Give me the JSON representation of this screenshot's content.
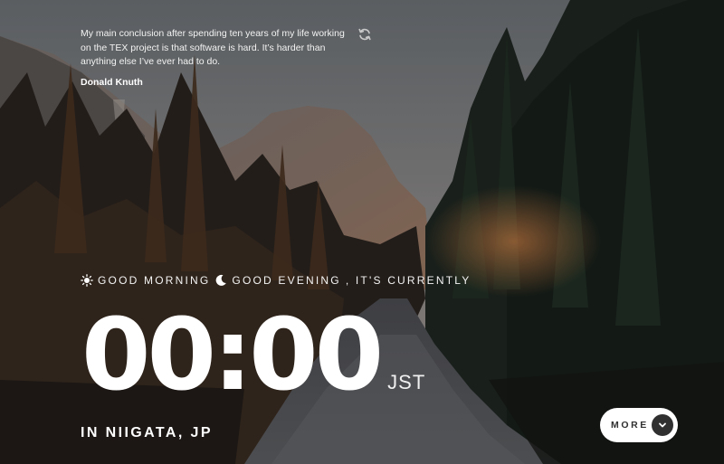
{
  "quote": {
    "text": "My main conclusion after spending ten years of my life working on the TEX project is that software is hard. It’s harder than anything else I’ve ever had to do.",
    "author": "Donald Knuth",
    "refresh_icon": "refresh-icon"
  },
  "greeting": {
    "morning": "GOOD MORNING",
    "evening": "GOOD EVENING",
    "suffix": ", IT'S CURRENTLY",
    "sun_icon": "sun-icon",
    "moon_icon": "moon-icon"
  },
  "clock": {
    "time": "00:00",
    "timezone": "JST"
  },
  "location": {
    "text": "IN NIIGATA, JP"
  },
  "more_button": {
    "label": "MORE",
    "icon": "chevron-down-icon"
  },
  "colors": {
    "button_bg": "#ffffff",
    "button_icon_bg": "#303030",
    "text": "#ffffff"
  }
}
